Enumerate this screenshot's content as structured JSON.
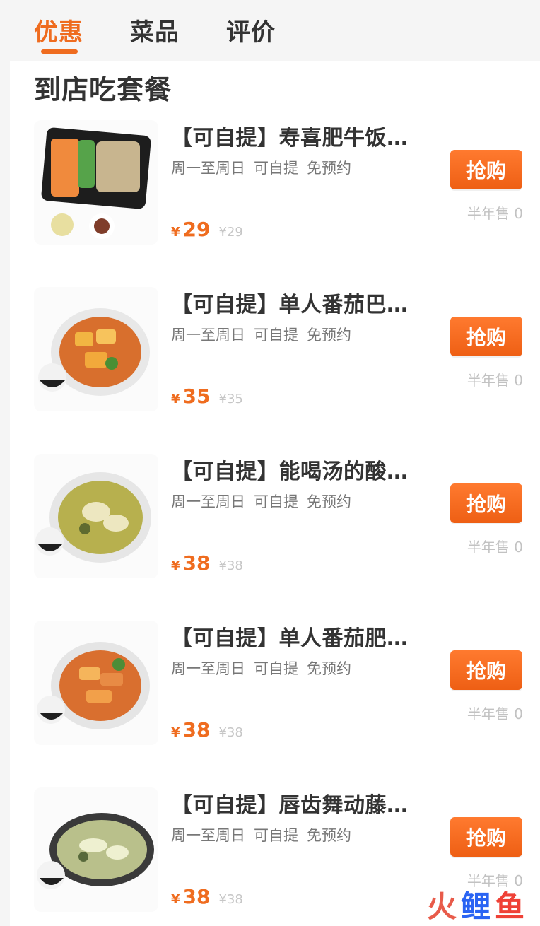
{
  "tabs": [
    {
      "label": "优惠",
      "active": true
    },
    {
      "label": "菜品",
      "active": false
    },
    {
      "label": "评价",
      "active": false
    }
  ],
  "section": {
    "title": "到店吃套餐"
  },
  "items": [
    {
      "name": "【可自提】寿喜肥牛饭…",
      "tags": [
        "周一至周日",
        "可自提",
        "免预约"
      ],
      "currency": "¥",
      "price": "29",
      "original_price": "¥29",
      "button": "抢购",
      "sales": "半年售 0",
      "image_icon": "beef-rice-bento-icon"
    },
    {
      "name": "【可自提】单人番茄巴…",
      "tags": [
        "周一至周日",
        "可自提",
        "免预约"
      ],
      "currency": "¥",
      "price": "35",
      "original_price": "¥35",
      "button": "抢购",
      "sales": "半年售 0",
      "image_icon": "tomato-hotpot-icon"
    },
    {
      "name": "【可自提】能喝汤的酸…",
      "tags": [
        "周一至周日",
        "可自提",
        "免预约"
      ],
      "currency": "¥",
      "price": "38",
      "original_price": "¥38",
      "button": "抢购",
      "sales": "半年售 0",
      "image_icon": "sour-soup-pot-icon"
    },
    {
      "name": "【可自提】单人番茄肥…",
      "tags": [
        "周一至周日",
        "可自提",
        "免预约"
      ],
      "currency": "¥",
      "price": "38",
      "original_price": "¥38",
      "button": "抢购",
      "sales": "半年售 0",
      "image_icon": "tomato-beef-pot-icon"
    },
    {
      "name": "【可自提】唇齿舞动藤…",
      "tags": [
        "周一至周日",
        "可自提",
        "免预约"
      ],
      "currency": "¥",
      "price": "38",
      "original_price": "¥38",
      "button": "抢购",
      "sales": "半年售 0",
      "image_icon": "green-pepper-fish-pot-icon"
    }
  ],
  "watermark": {
    "chars": [
      "火",
      "鲤",
      "鱼"
    ]
  },
  "colors": {
    "accent": "#ef6c1f",
    "button_start": "#ff7a2f",
    "button_end": "#ee5f14",
    "text": "#333333",
    "muted": "#777777",
    "light": "#c2c2c2"
  }
}
